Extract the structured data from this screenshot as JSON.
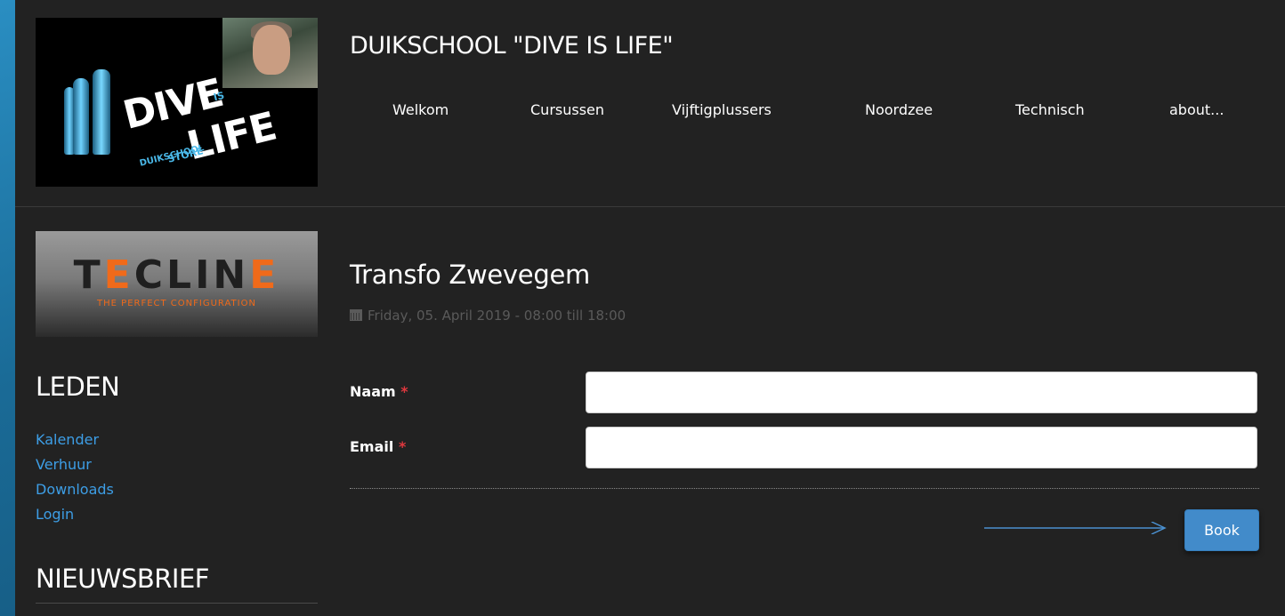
{
  "header": {
    "site_title": "DUIKSCHOOL \"DIVE IS LIFE\"",
    "logo": {
      "dive": "DIVE",
      "is": "IS",
      "life": "LIFE",
      "store": "STORE",
      "duikschool": "DUIKSCHOOL"
    },
    "nav": [
      {
        "label": "Welkom"
      },
      {
        "label": "Cursussen"
      },
      {
        "label": "Vijftigplussers"
      },
      {
        "label": "Noordzee"
      },
      {
        "label": "Technisch"
      },
      {
        "label": "about..."
      }
    ]
  },
  "sidebar": {
    "banner": {
      "brand_left": "T",
      "brand_accent_1": "E",
      "brand_mid": "CLIN",
      "brand_accent_2": "E",
      "slogan": "THE PERFECT CONFIGURATION"
    },
    "leden_heading": "LEDEN",
    "links": [
      {
        "label": "Kalender"
      },
      {
        "label": "Verhuur"
      },
      {
        "label": "Downloads"
      },
      {
        "label": "Login"
      }
    ],
    "nieuwsbrief_heading": "NIEUWSBRIEF"
  },
  "event": {
    "title": "Transfo Zwevegem",
    "date": "Friday, 05. April 2019 - 08:00 till 18:00"
  },
  "form": {
    "name_label": "Naam",
    "email_label": "Email",
    "required_marker": "*",
    "name_value": "",
    "email_value": "",
    "book_label": "Book"
  },
  "colors": {
    "link": "#3d9ee6",
    "button": "#428bca",
    "required": "#e0383e",
    "accent": "#f06a1a",
    "background_panel": "#222222"
  },
  "icons": {
    "date": "calendar-icon",
    "annotation": "arrow-right-icon"
  }
}
